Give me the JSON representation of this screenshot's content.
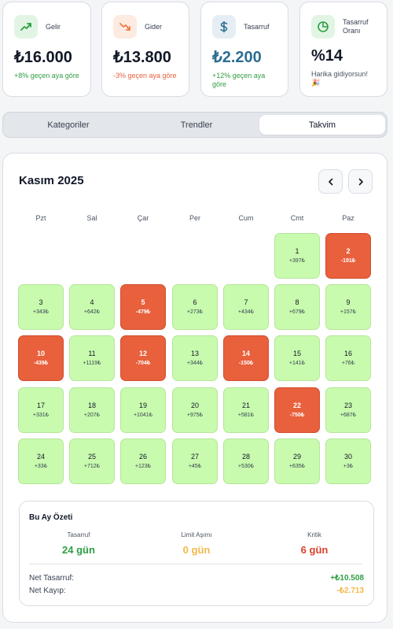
{
  "cards": [
    {
      "label": "Gelir",
      "value": "₺16.000",
      "sub": "+8% geçen aya göre",
      "icon": "trending-up-icon"
    },
    {
      "label": "Gider",
      "value": "₺13.800",
      "sub": "-3% geçen aya göre",
      "icon": "trending-down-icon"
    },
    {
      "label": "Tasarruf",
      "value": "₺2.200",
      "sub": "+12% geçen aya göre",
      "icon": "dollar-icon"
    },
    {
      "label": "Tasarruf Oranı",
      "value": "%14",
      "sub": "Harika gidiyorsun! 🎉",
      "icon": "pie-chart-icon"
    }
  ],
  "tabs": [
    "Kategoriler",
    "Trendler",
    "Takvim"
  ],
  "active_tab": "Takvim",
  "calendar": {
    "title": "Kasım 2025",
    "weekdays": [
      "Pzt",
      "Sal",
      "Çar",
      "Per",
      "Cum",
      "Cmt",
      "Paz"
    ],
    "days": [
      {
        "day": "1",
        "amount": "+397₺"
      },
      {
        "day": "2",
        "amount": "-191₺"
      },
      {
        "day": "3",
        "amount": "+343₺"
      },
      {
        "day": "4",
        "amount": "+642₺"
      },
      {
        "day": "5",
        "amount": "-479₺"
      },
      {
        "day": "6",
        "amount": "+273₺"
      },
      {
        "day": "7",
        "amount": "+434₺"
      },
      {
        "day": "8",
        "amount": "+679₺"
      },
      {
        "day": "9",
        "amount": "+157₺"
      },
      {
        "day": "10",
        "amount": "-439₺"
      },
      {
        "day": "11",
        "amount": "+1119₺"
      },
      {
        "day": "12",
        "amount": "-704₺"
      },
      {
        "day": "13",
        "amount": "+344₺"
      },
      {
        "day": "14",
        "amount": "-150₺"
      },
      {
        "day": "15",
        "amount": "+141₺"
      },
      {
        "day": "16",
        "amount": "+76₺"
      },
      {
        "day": "17",
        "amount": "+331₺"
      },
      {
        "day": "18",
        "amount": "+207₺"
      },
      {
        "day": "19",
        "amount": "+1041₺"
      },
      {
        "day": "20",
        "amount": "+975₺"
      },
      {
        "day": "21",
        "amount": "+581₺"
      },
      {
        "day": "22",
        "amount": "-750₺"
      },
      {
        "day": "23",
        "amount": "+687₺"
      },
      {
        "day": "24",
        "amount": "+33₺"
      },
      {
        "day": "25",
        "amount": "+712₺"
      },
      {
        "day": "26",
        "amount": "+123₺"
      },
      {
        "day": "27",
        "amount": "+45₺"
      },
      {
        "day": "28",
        "amount": "+530₺"
      },
      {
        "day": "29",
        "amount": "+635₺"
      },
      {
        "day": "30",
        "amount": "+3₺"
      }
    ]
  },
  "summary": {
    "title": "Bu Ay Özeti",
    "stats": [
      {
        "label": "Tasarruf",
        "value": "24 gün",
        "color": "#2f9e44"
      },
      {
        "label": "Limit Aşımı",
        "value": "0 gün",
        "color": "#f2b84b"
      },
      {
        "label": "Kritik",
        "value": "6 gün",
        "color": "#d9412b"
      }
    ],
    "net_savings_label": "Net Tasarruf:",
    "net_savings_value": "+₺10.508",
    "net_loss_label": "Net Kayıp:",
    "net_loss_value": "-₺2.713"
  },
  "colors": {
    "positive_day": "#c8fbae",
    "negative_day": "#e8603c",
    "income_accent": "#2f9e44",
    "expense_accent": "#f07b45",
    "savings_accent": "#2b6e92",
    "rate_accent": "#2f9e44"
  }
}
